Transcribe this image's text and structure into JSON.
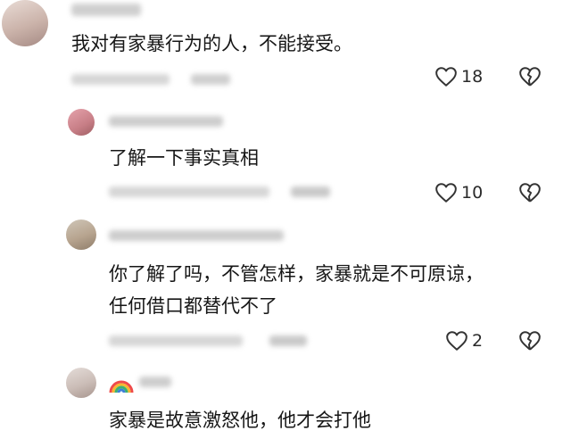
{
  "comments": [
    {
      "text_lines": [
        "我对有家暴行为的人，不能接受。"
      ],
      "like_count": "18",
      "reply": false
    },
    {
      "text_lines": [
        "了解一下事实真相"
      ],
      "like_count": "10",
      "reply": true
    },
    {
      "text_lines": [
        "你了解了吗，不管怎样，家暴就是不可原谅，",
        "任何借口都替代不了"
      ],
      "like_count": "2",
      "reply": true
    },
    {
      "text_lines": [
        "家暴是故意激怒他，他才会打他"
      ],
      "like_count": "",
      "reply": true
    }
  ],
  "icons": {
    "like": "heart-outline-icon",
    "dislike": "broken-heart-icon",
    "badge": "rainbow-icon"
  },
  "colors": {
    "text": "#161616",
    "icon": "#333333"
  }
}
